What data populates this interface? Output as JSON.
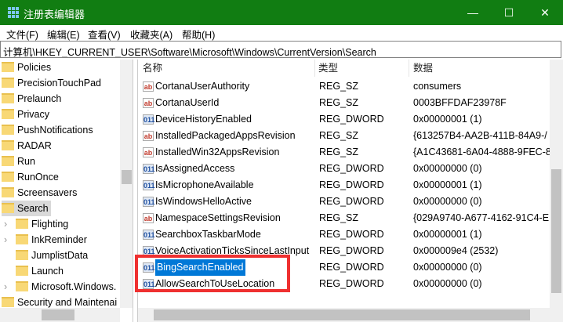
{
  "window": {
    "title": "注册表编辑器",
    "minimize": "—",
    "maximize": "☐",
    "close": "✕"
  },
  "menu": [
    "文件(F)",
    "编辑(E)",
    "查看(V)",
    "收藏夹(A)",
    "帮助(H)"
  ],
  "address": "计算机\\HKEY_CURRENT_USER\\Software\\Microsoft\\Windows\\CurrentVersion\\Search",
  "tree": [
    {
      "label": "Policies",
      "level": 0
    },
    {
      "label": "PrecisionTouchPad",
      "level": 0
    },
    {
      "label": "Prelaunch",
      "level": 0
    },
    {
      "label": "Privacy",
      "level": 0
    },
    {
      "label": "PushNotifications",
      "level": 0
    },
    {
      "label": "RADAR",
      "level": 0
    },
    {
      "label": "Run",
      "level": 0
    },
    {
      "label": "RunOnce",
      "level": 0
    },
    {
      "label": "Screensavers",
      "level": 0
    },
    {
      "label": "Search",
      "level": 0,
      "selected": true
    },
    {
      "label": "Flighting",
      "level": 1,
      "expander": true
    },
    {
      "label": "InkReminder",
      "level": 1,
      "expander": true
    },
    {
      "label": "JumplistData",
      "level": 1
    },
    {
      "label": "Launch",
      "level": 1
    },
    {
      "label": "Microsoft.Windows.",
      "level": 1,
      "expander": true
    },
    {
      "label": "Security and Maintenai",
      "level": 0
    }
  ],
  "columns": {
    "name": "名称",
    "type": "类型",
    "data": "数据"
  },
  "values": [
    {
      "name": "CortanaUserAuthority",
      "type": "REG_SZ",
      "data": "consumers"
    },
    {
      "name": "CortanaUserId",
      "type": "REG_SZ",
      "data": "0003BFFDAF23978F"
    },
    {
      "name": "DeviceHistoryEnabled",
      "type": "REG_DWORD",
      "data": "0x00000001 (1)"
    },
    {
      "name": "InstalledPackagedAppsRevision",
      "type": "REG_SZ",
      "data": "{613257B4-AA2B-411B-84A9-/"
    },
    {
      "name": "InstalledWin32AppsRevision",
      "type": "REG_SZ",
      "data": "{A1C43681-6A04-4888-9FEC-8"
    },
    {
      "name": "IsAssignedAccess",
      "type": "REG_DWORD",
      "data": "0x00000000 (0)"
    },
    {
      "name": "IsMicrophoneAvailable",
      "type": "REG_DWORD",
      "data": "0x00000001 (1)"
    },
    {
      "name": "IsWindowsHelloActive",
      "type": "REG_DWORD",
      "data": "0x00000000 (0)"
    },
    {
      "name": "NamespaceSettingsRevision",
      "type": "REG_SZ",
      "data": "{029A9740-A677-4162-91C4-E"
    },
    {
      "name": "SearchboxTaskbarMode",
      "type": "REG_DWORD",
      "data": "0x00000001 (1)"
    },
    {
      "name": "VoiceActivationTicksSinceLastInput",
      "type": "REG_DWORD",
      "data": "0x000009e4 (2532)"
    },
    {
      "name": "BingSearchEnabled",
      "type": "REG_DWORD",
      "data": "0x00000000 (0)",
      "selected": true
    },
    {
      "name": "AllowSearchToUseLocation",
      "type": "REG_DWORD",
      "data": "0x00000000 (0)"
    }
  ],
  "icons": {
    "REG_SZ": "ab",
    "REG_DWORD": "011"
  }
}
